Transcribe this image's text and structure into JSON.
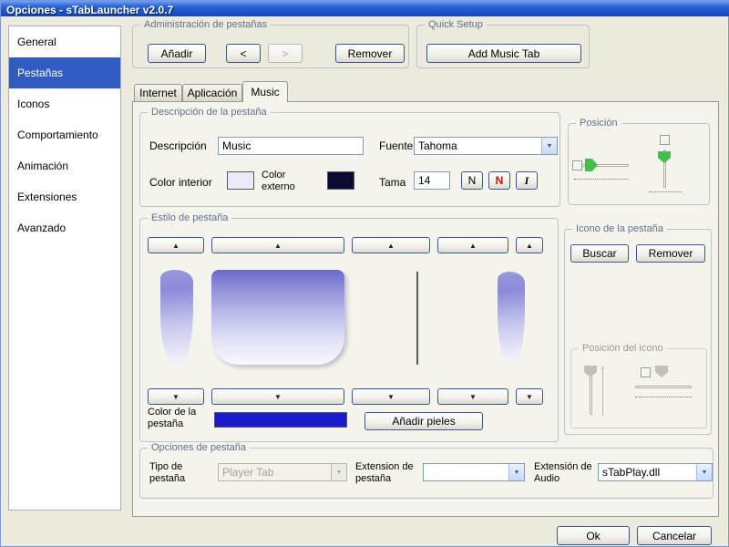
{
  "window": {
    "title": "Opciones - sTabLauncher v2.0.7"
  },
  "sidebar": {
    "items": [
      {
        "label": "General",
        "selected": false
      },
      {
        "label": "Pestañas",
        "selected": true
      },
      {
        "label": "Iconos",
        "selected": false
      },
      {
        "label": "Comportamiento",
        "selected": false
      },
      {
        "label": "Animación",
        "selected": false
      },
      {
        "label": "Extensiones",
        "selected": false
      },
      {
        "label": "Avanzado",
        "selected": false
      }
    ]
  },
  "tab_admin": {
    "title": "Administración de pestañas",
    "add_label": "Añadir",
    "prev_label": "<",
    "next_label": ">",
    "remove_label": "Remover"
  },
  "quick_setup": {
    "title": "Quick Setup",
    "add_music_tab_label": "Add Music Tab"
  },
  "tabs": [
    {
      "label": "Internet"
    },
    {
      "label": "Aplicación"
    },
    {
      "label": "Music"
    }
  ],
  "active_tab": "Music",
  "description_group": {
    "title": "Descripción de la pestaña",
    "description_label": "Descripción",
    "description_value": "Music",
    "font_label": "Fuente",
    "font_value": "Tahoma",
    "inner_color_label": "Color interior",
    "outer_color_label": "Color externo",
    "size_label": "Tama",
    "size_value": "14",
    "bold_label": "N",
    "bold_red_label": "N",
    "italic_label": "I"
  },
  "position_group": {
    "title": "Posición"
  },
  "style_group": {
    "title": "Estilo de pestaña",
    "up_arrow": "▲",
    "down_arrow": "▼",
    "tab_color_label": "Color de la pestaña",
    "add_skins_label": "Añadir pieles"
  },
  "icon_group": {
    "title": "Icono de la pestaña",
    "browse_label": "Buscar",
    "remove_label": "Remover",
    "icon_position_title": "Posición del icono"
  },
  "options_group": {
    "title": "Opciones de pestaña",
    "type_label": "Tipo de pestaña",
    "type_value": "Player Tab",
    "tab_extension_label": "Extension de pestaña",
    "tab_extension_value": "",
    "audio_extension_label": "Extensión de Audio",
    "audio_extension_value": "sTabPlay.dll"
  },
  "footer": {
    "ok_label": "Ok",
    "cancel_label": "Cancelar"
  },
  "colors": {
    "titlebar": "#2A63D4",
    "sidebar_selected": "#2F5BC2",
    "inner_color_swatch": "#EAEAF8",
    "outer_color_swatch": "#0A0A32",
    "tab_color_swatch": "#1B1BD0",
    "slider_thumb_green": "#44BE4E"
  }
}
